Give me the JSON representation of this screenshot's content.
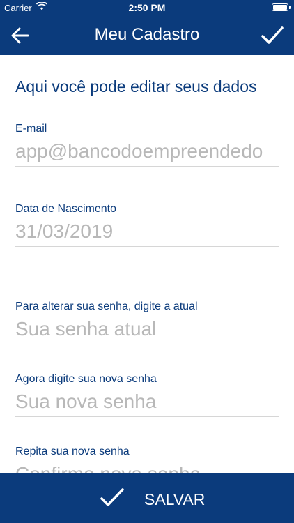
{
  "status_bar": {
    "carrier": "Carrier",
    "time": "2:50 PM"
  },
  "header": {
    "title": "Meu Cadastro",
    "back_icon": "back-arrow-icon",
    "confirm_icon": "checkmark-icon"
  },
  "main": {
    "heading": "Aqui você pode editar seus dados",
    "email": {
      "label": "E-mail",
      "value": "app@bancodoempreendedo"
    },
    "birthdate": {
      "label": "Data de Nascimento",
      "value": "31/03/2019"
    },
    "current_password": {
      "label": "Para alterar sua senha, digite a atual",
      "placeholder": "Sua senha atual"
    },
    "new_password": {
      "label": "Agora digite sua nova senha",
      "placeholder": "Sua nova senha"
    },
    "repeat_password": {
      "label": "Repita sua nova senha",
      "placeholder": "Confirme nova senha"
    }
  },
  "footer": {
    "save_label": "SALVAR"
  },
  "colors": {
    "brand": "#0b3b7c",
    "placeholder": "#b8b8b8",
    "divider": "#d6d6d6"
  }
}
